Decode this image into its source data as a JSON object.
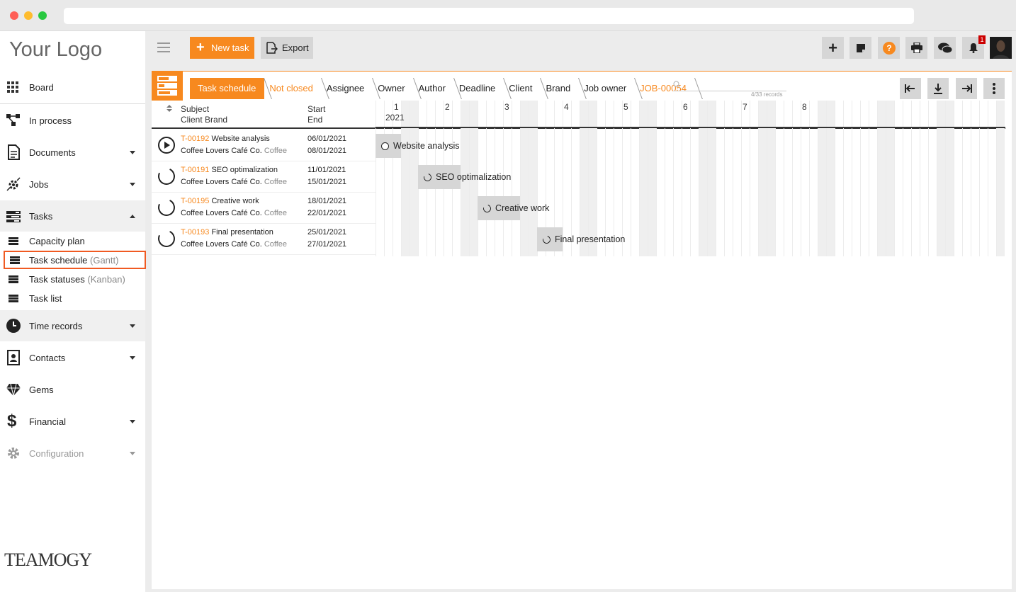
{
  "browser": {
    "dots": [
      "#fe5f57",
      "#febc2e",
      "#28c840"
    ]
  },
  "logo": "Your Logo",
  "brand_footer": "TEAMOGY",
  "nav": [
    {
      "label": "Board",
      "icon": "grid-icon"
    },
    {
      "label": "In process",
      "icon": "process-icon"
    },
    {
      "label": "Documents",
      "icon": "document-icon"
    },
    {
      "label": "Jobs",
      "icon": "jobs-icon"
    },
    {
      "label": "Tasks",
      "icon": "tasks-icon"
    },
    {
      "label": "Time records",
      "icon": "clock-icon"
    },
    {
      "label": "Contacts",
      "icon": "contacts-icon"
    },
    {
      "label": "Gems",
      "icon": "gem-icon"
    },
    {
      "label": "Financial",
      "icon": "dollar-icon"
    },
    {
      "label": "Configuration",
      "icon": "gear-icon"
    }
  ],
  "subnav": [
    {
      "label": "Capacity plan",
      "suffix": ""
    },
    {
      "label": "Task schedule",
      "suffix": "(Gantt)"
    },
    {
      "label": "Task statuses",
      "suffix": "(Kanban)"
    },
    {
      "label": "Task list",
      "suffix": ""
    }
  ],
  "toolbar": {
    "new_task": "New task",
    "export": "Export",
    "notification_count": "1"
  },
  "breadcrumb": [
    "Task schedule",
    "Not closed",
    "Assignee",
    "Owner",
    "Author",
    "Deadline",
    "Client",
    "Brand",
    "Job owner",
    "JOB-00054"
  ],
  "records": "4/33 records",
  "columns": {
    "subject": "Subject",
    "client_brand": "Client Brand",
    "start": "Start",
    "end": "End"
  },
  "timeline": {
    "year": "2021",
    "weeks": [
      "1",
      "2",
      "3",
      "4",
      "5",
      "6",
      "7",
      "8"
    ]
  },
  "tasks": [
    {
      "id": "T-00192",
      "subject": "Website analysis",
      "client": "Coffee Lovers Café Co.",
      "brand": "Coffee",
      "start": "06/01/2021",
      "end": "08/01/2021",
      "status": "running"
    },
    {
      "id": "T-00191",
      "subject": "SEO optimalization",
      "client": "Coffee Lovers Café Co.",
      "brand": "Coffee",
      "start": "11/01/2021",
      "end": "15/01/2021",
      "status": "open"
    },
    {
      "id": "T-00195",
      "subject": "Creative work",
      "client": "Coffee Lovers Café Co.",
      "brand": "Coffee",
      "start": "18/01/2021",
      "end": "22/01/2021",
      "status": "open"
    },
    {
      "id": "T-00193",
      "subject": "Final presentation",
      "client": "Coffee Lovers Café Co.",
      "brand": "Coffee",
      "start": "25/01/2021",
      "end": "27/01/2021",
      "status": "open"
    }
  ],
  "colors": {
    "accent": "#f7891f",
    "badge": "#cc0000"
  }
}
